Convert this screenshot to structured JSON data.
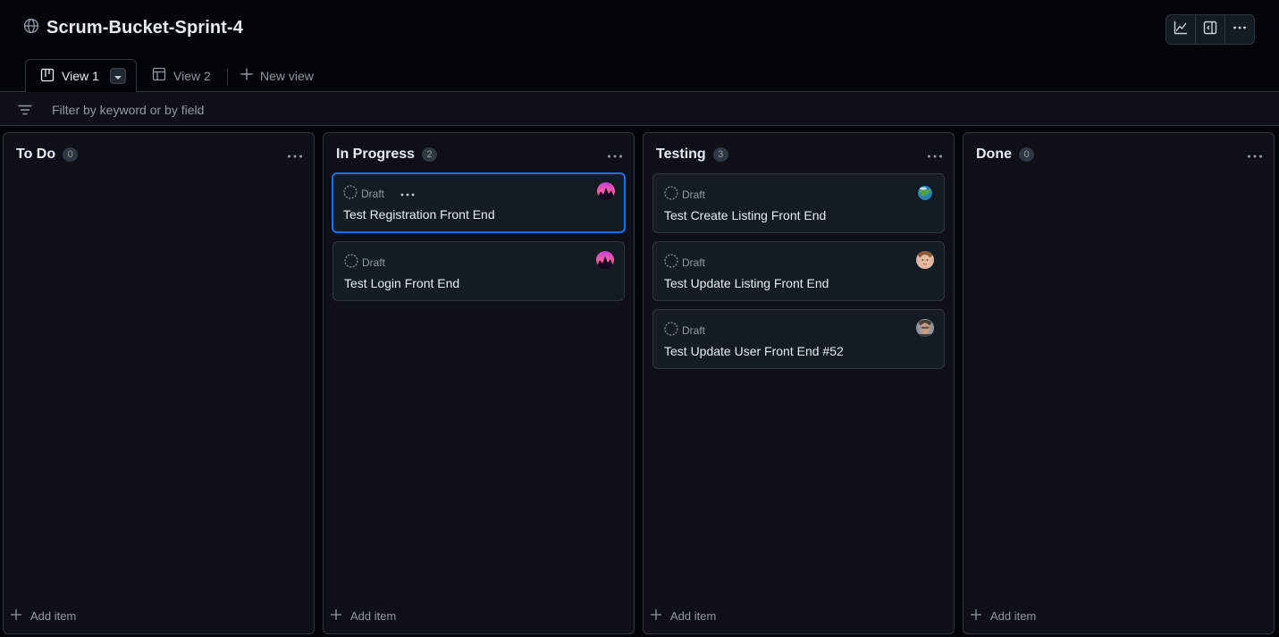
{
  "project": {
    "title": "Scrum-Bucket-Sprint-4"
  },
  "tabs": [
    {
      "label": "View 1"
    },
    {
      "label": "View 2"
    },
    {
      "label": "New view"
    }
  ],
  "filter": {
    "placeholder": "Filter by keyword or by field"
  },
  "columns": [
    {
      "title": "To Do",
      "count": "0",
      "add_label": "Add item",
      "cards": []
    },
    {
      "title": "In Progress",
      "count": "2",
      "add_label": "Add item",
      "cards": [
        {
          "status": "Draft",
          "title": "Test Registration Front End",
          "avatar": "avatar-sunset"
        },
        {
          "status": "Draft",
          "title": "Test Login Front End",
          "avatar": "avatar-sunset"
        }
      ]
    },
    {
      "title": "Testing",
      "count": "3",
      "add_label": "Add item",
      "cards": [
        {
          "status": "Draft",
          "title": "Test Create Listing Front End",
          "avatar": "avatar-earth"
        },
        {
          "status": "Draft",
          "title": "Test Update Listing Front End",
          "avatar": "avatar-face-light"
        },
        {
          "status": "Draft",
          "title": "Test Update User Front End #52",
          "avatar": "avatar-face-dark"
        }
      ]
    },
    {
      "title": "Done",
      "count": "0",
      "add_label": "Add item",
      "cards": []
    }
  ],
  "icons": {
    "project": "globe-icon",
    "toolbar": [
      "graph-icon",
      "sidebar-icon",
      "kebab-icon"
    ],
    "view1": "board-icon",
    "view2": "table-icon",
    "new_view": "plus-icon",
    "filter": "filter-icon",
    "draft": "draft-circle-icon"
  },
  "colors": {
    "background": "#010409",
    "surface": "#0d1117",
    "card": "#151b23",
    "border": "#30363d",
    "accent": "#1f6feb",
    "text": "#e6edf3",
    "muted": "#9198a1"
  }
}
